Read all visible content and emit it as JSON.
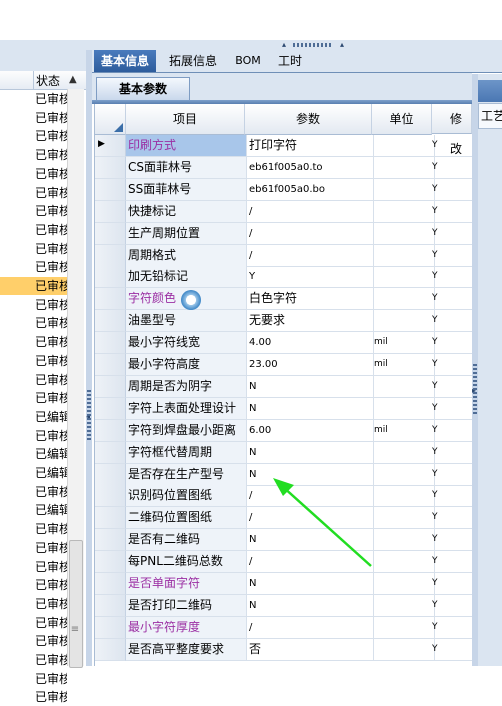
{
  "left_panel": {
    "column_header": "状态",
    "sort_icon": "triangle-up-icon",
    "statuses": [
      "已审核",
      "已审核",
      "已审核",
      "已审核",
      "已审核",
      "已审核",
      "已审核",
      "已审核",
      "已审核",
      "已审核",
      "已审核",
      "已审核",
      "已审核",
      "已审核",
      "已审核",
      "已审核",
      "已审核",
      "已编辑",
      "已审核",
      "已编辑",
      "已编辑",
      "已审核",
      "已编辑",
      "已审核",
      "已审核",
      "已审核",
      "已审核",
      "已审核",
      "已审核",
      "已审核",
      "已审核",
      "已审核",
      "已审核"
    ],
    "selected_index": 10,
    "selected_color": "#ffcf6a"
  },
  "tabs": [
    {
      "label": "基本信息",
      "active": true
    },
    {
      "label": "拓展信息",
      "active": false
    },
    {
      "label": "BOM",
      "active": false
    },
    {
      "label": "工时",
      "active": false
    }
  ],
  "subtab": {
    "label": "基本参数"
  },
  "right_panel": {
    "tab_label": "工艺"
  },
  "grid": {
    "headers": {
      "item": "项目",
      "param": "参数",
      "unit": "单位",
      "modify": "修改"
    },
    "rows": [
      {
        "item": "印刷方式",
        "param": "打印字符",
        "unit": "",
        "flag": "Y",
        "purple": true,
        "current": true
      },
      {
        "item": "CS面菲林号",
        "param": "eb61f005a0.to",
        "unit": "",
        "flag": "Y"
      },
      {
        "item": "SS面菲林号",
        "param": "eb61f005a0.bo",
        "unit": "",
        "flag": "Y"
      },
      {
        "item": "快捷标记",
        "param": "/",
        "unit": "",
        "flag": "Y"
      },
      {
        "item": "生产周期位置",
        "param": "/",
        "unit": "",
        "flag": "Y"
      },
      {
        "item": "周期格式",
        "param": "/",
        "unit": "",
        "flag": "Y"
      },
      {
        "item": "加无铅标记",
        "param": "Y",
        "unit": "",
        "flag": "Y"
      },
      {
        "item": "字符颜色",
        "param": "白色字符",
        "unit": "",
        "flag": "Y",
        "purple": true
      },
      {
        "item": "油墨型号",
        "param": "无要求",
        "unit": "",
        "flag": "Y"
      },
      {
        "item": "最小字符线宽",
        "param": "4.00",
        "unit": "mil",
        "flag": "Y"
      },
      {
        "item": "最小字符高度",
        "param": "23.00",
        "unit": "mil",
        "flag": "Y"
      },
      {
        "item": "周期是否为阴字",
        "param": "N",
        "unit": "",
        "flag": "Y"
      },
      {
        "item": "字符上表面处理设计",
        "param": "N",
        "unit": "",
        "flag": "Y"
      },
      {
        "item": "字符到焊盘最小距离",
        "param": "6.00",
        "unit": "mil",
        "flag": "Y"
      },
      {
        "item": "字符框代替周期",
        "param": "N",
        "unit": "",
        "flag": "Y"
      },
      {
        "item": "是否存在生产型号",
        "param": "N",
        "unit": "",
        "flag": "Y"
      },
      {
        "item": "识别码位置图纸",
        "param": "/",
        "unit": "",
        "flag": "Y"
      },
      {
        "item": "二维码位置图纸",
        "param": "/",
        "unit": "",
        "flag": "Y"
      },
      {
        "item": "是否有二维码",
        "param": "N",
        "unit": "",
        "flag": "Y"
      },
      {
        "item": "每PNL二维码总数",
        "param": "/",
        "unit": "",
        "flag": "Y"
      },
      {
        "item": "是否单面字符",
        "param": "N",
        "unit": "",
        "flag": "Y",
        "purple": true
      },
      {
        "item": "是否打印二维码",
        "param": "N",
        "unit": "",
        "flag": "Y"
      },
      {
        "item": "最小字符厚度",
        "param": "/",
        "unit": "",
        "flag": "Y",
        "purple": true
      },
      {
        "item": "是否高平整度要求",
        "param": "否",
        "unit": "",
        "flag": "Y"
      }
    ]
  },
  "annotation": {
    "color": "#22dd22"
  }
}
